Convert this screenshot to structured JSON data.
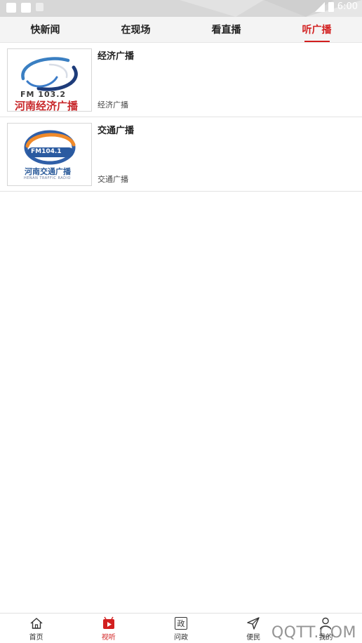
{
  "status_bar": {
    "time": "6:00"
  },
  "tabs": [
    {
      "label": "快新闻",
      "active": false
    },
    {
      "label": "在现场",
      "active": false
    },
    {
      "label": "看直播",
      "active": false
    },
    {
      "label": "听广播",
      "active": true
    }
  ],
  "list": [
    {
      "title": "经济广播",
      "subtitle": "经济广播",
      "logo": {
        "fm_text": "FM 103.2",
        "name_text": "河南经济广播"
      }
    },
    {
      "title": "交通广播",
      "subtitle": "交通广播",
      "logo": {
        "fm_text": "FM104.1",
        "name_text": "河南交通广播",
        "en_text": "HENAN TRAFFIC RADIO"
      }
    }
  ],
  "bottom_nav": [
    {
      "label": "首页",
      "icon": "home-icon",
      "active": false
    },
    {
      "label": "视听",
      "icon": "video-play-icon",
      "active": true
    },
    {
      "label": "问政",
      "icon": "zheng-icon",
      "icon_char": "政",
      "active": false
    },
    {
      "label": "便民",
      "icon": "send-icon",
      "active": false
    },
    {
      "label": "我的",
      "icon": "user-icon",
      "active": false
    }
  ],
  "watermark": "QQTT.COM",
  "colors": {
    "accent": "#d21f1f",
    "tab_bg": "#f4f4f4",
    "status_bar": "#d7d7d7"
  }
}
